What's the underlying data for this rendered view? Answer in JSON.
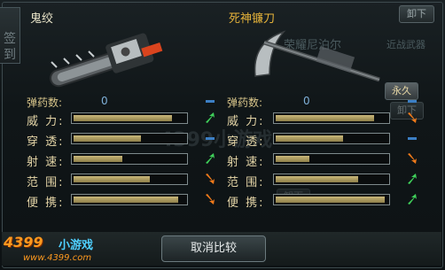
{
  "left_tab": {
    "chars": [
      "签",
      "到"
    ]
  },
  "left_weapon": {
    "name": "鬼绞",
    "name_color": "#e8e3c8"
  },
  "right_weapon": {
    "name": "死神镰刀",
    "name_color": "#e6b33a",
    "bg_name": "荣耀尼泊尔",
    "bg_type": "近战武器"
  },
  "buttons": {
    "unequip": "卸下",
    "permanent": "永久",
    "unequip2": "卸下",
    "cancel_compare": "取消比较",
    "bg_unequip": "卸下"
  },
  "ammo": {
    "label": "弹药数:",
    "left_value": "0",
    "right_value": "0"
  },
  "stats": [
    {
      "label": "威  力:",
      "left": 0.88,
      "right": 0.88,
      "left_arrow": "up",
      "right_arrow": "down"
    },
    {
      "label": "穿  透:",
      "left": 0.6,
      "right": 0.6,
      "left_arrow": "none",
      "right_arrow": "none"
    },
    {
      "label": "射  速:",
      "left": 0.44,
      "right": 0.3,
      "left_arrow": "up",
      "right_arrow": "down"
    },
    {
      "label": "范  围:",
      "left": 0.68,
      "right": 0.74,
      "left_arrow": "down",
      "right_arrow": "up"
    },
    {
      "label": "便  携:",
      "left": 0.94,
      "right": 0.98,
      "left_arrow": "down",
      "right_arrow": "up"
    }
  ],
  "watermark": "4399小游戏",
  "logo": {
    "main": "4399",
    "sub": "小游戏",
    "url": "www.4399.com"
  },
  "colors": {
    "up": "#3fd05a",
    "down": "#f07a1a",
    "accent": "#3c7fc4"
  }
}
